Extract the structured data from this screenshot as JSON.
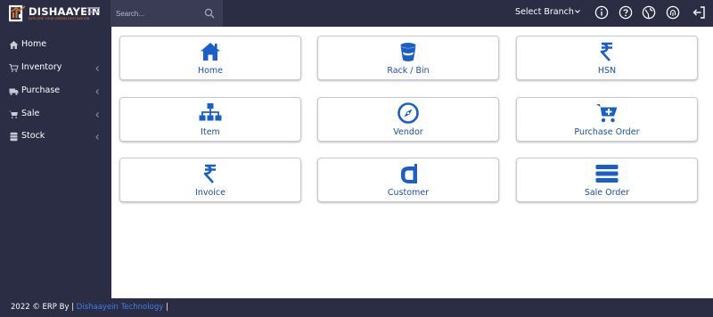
{
  "brand": {
    "name": "DISHAAYEIN",
    "tagline": "EXPLORE YOUR DREAM DESTINATION",
    "accent": "#e07a2a"
  },
  "search": {
    "placeholder": "Search..."
  },
  "header": {
    "branch_label": "Select Branch",
    "icons": [
      "info-icon",
      "help-icon",
      "globe-icon",
      "fingerprint-icon",
      "logout-icon"
    ]
  },
  "sidebar": {
    "items": [
      {
        "label": "Home",
        "icon": "home-icon"
      },
      {
        "label": "Inventory",
        "icon": "cart-icon"
      },
      {
        "label": "Purchase",
        "icon": "truck-icon"
      },
      {
        "label": "Sale",
        "icon": "cart-icon"
      },
      {
        "label": "Stock",
        "icon": "database-icon"
      }
    ]
  },
  "tiles": [
    {
      "label": "Home",
      "icon": "home-icon"
    },
    {
      "label": "Rack / Bin",
      "icon": "bucket-icon"
    },
    {
      "label": "HSN",
      "icon": "rupee-icon"
    },
    {
      "label": "Item",
      "icon": "sitemap-icon"
    },
    {
      "label": "Vendor",
      "icon": "compass-icon"
    },
    {
      "label": "Purchase Order",
      "icon": "cart-plus-icon"
    },
    {
      "label": "Invoice",
      "icon": "rupee-icon"
    },
    {
      "label": "Customer",
      "icon": "customer-icon"
    },
    {
      "label": "Sale Order",
      "icon": "stacked-bars-icon"
    }
  ],
  "footer": {
    "prefix": "2022 © ERP By  |",
    "link": "Dishaayein Technology",
    "suffix": " |"
  },
  "colors": {
    "header_bg": "#2b2d44",
    "sidebar_bg": "#2b2d44",
    "tile_icon": "#1a5fc8",
    "tile_label": "#1a4fa8",
    "footer_link": "#3d7eea"
  }
}
